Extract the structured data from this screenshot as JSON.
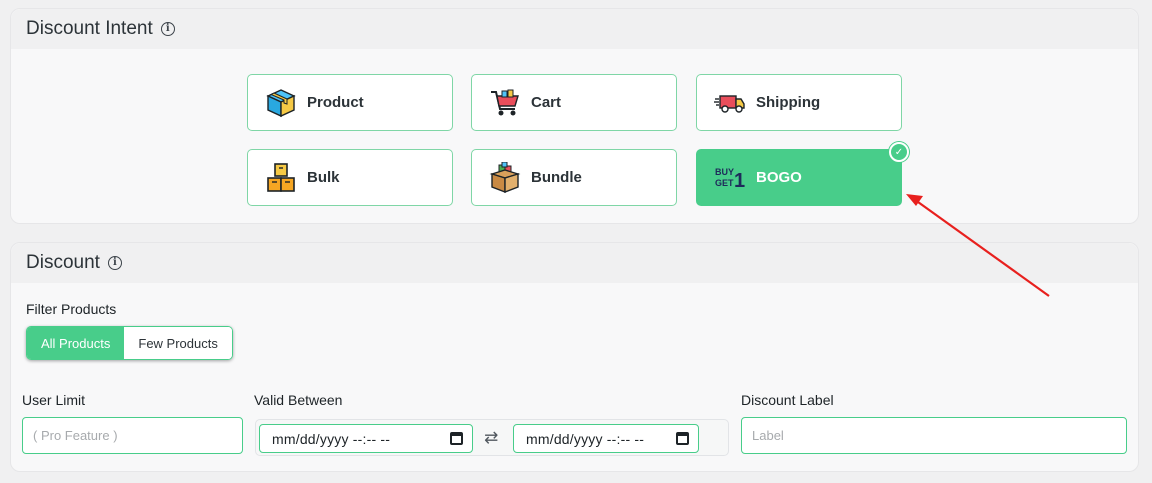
{
  "intent": {
    "title": "Discount Intent",
    "info_icon": "i",
    "cards": [
      {
        "label": "Product",
        "icon": "box-icon"
      },
      {
        "label": "Cart",
        "icon": "cart-icon"
      },
      {
        "label": "Shipping",
        "icon": "truck-icon"
      },
      {
        "label": "Bulk",
        "icon": "stacked-boxes-icon"
      },
      {
        "label": "Bundle",
        "icon": "bundle-box-icon"
      },
      {
        "label": "BOGO",
        "icon": "buy-get-one-icon",
        "selected": true
      }
    ]
  },
  "discount": {
    "title": "Discount",
    "info_icon": "i",
    "filter_label": "Filter Products",
    "filter_options": [
      "All Products",
      "Few Products"
    ],
    "user_limit_label": "User Limit",
    "user_limit_placeholder": "( Pro Feature )",
    "valid_between_label": "Valid Between",
    "date_start": "mm/dd/yyyy --:-- --",
    "date_end": "mm/dd/yyyy --:-- --",
    "swap_icon": "⇄",
    "discount_label_label": "Discount Label",
    "discount_label_placeholder": "Label"
  },
  "colors": {
    "accent": "#48cd8a",
    "card_border": "#7fd6a6",
    "arrow": "#e8201e"
  }
}
